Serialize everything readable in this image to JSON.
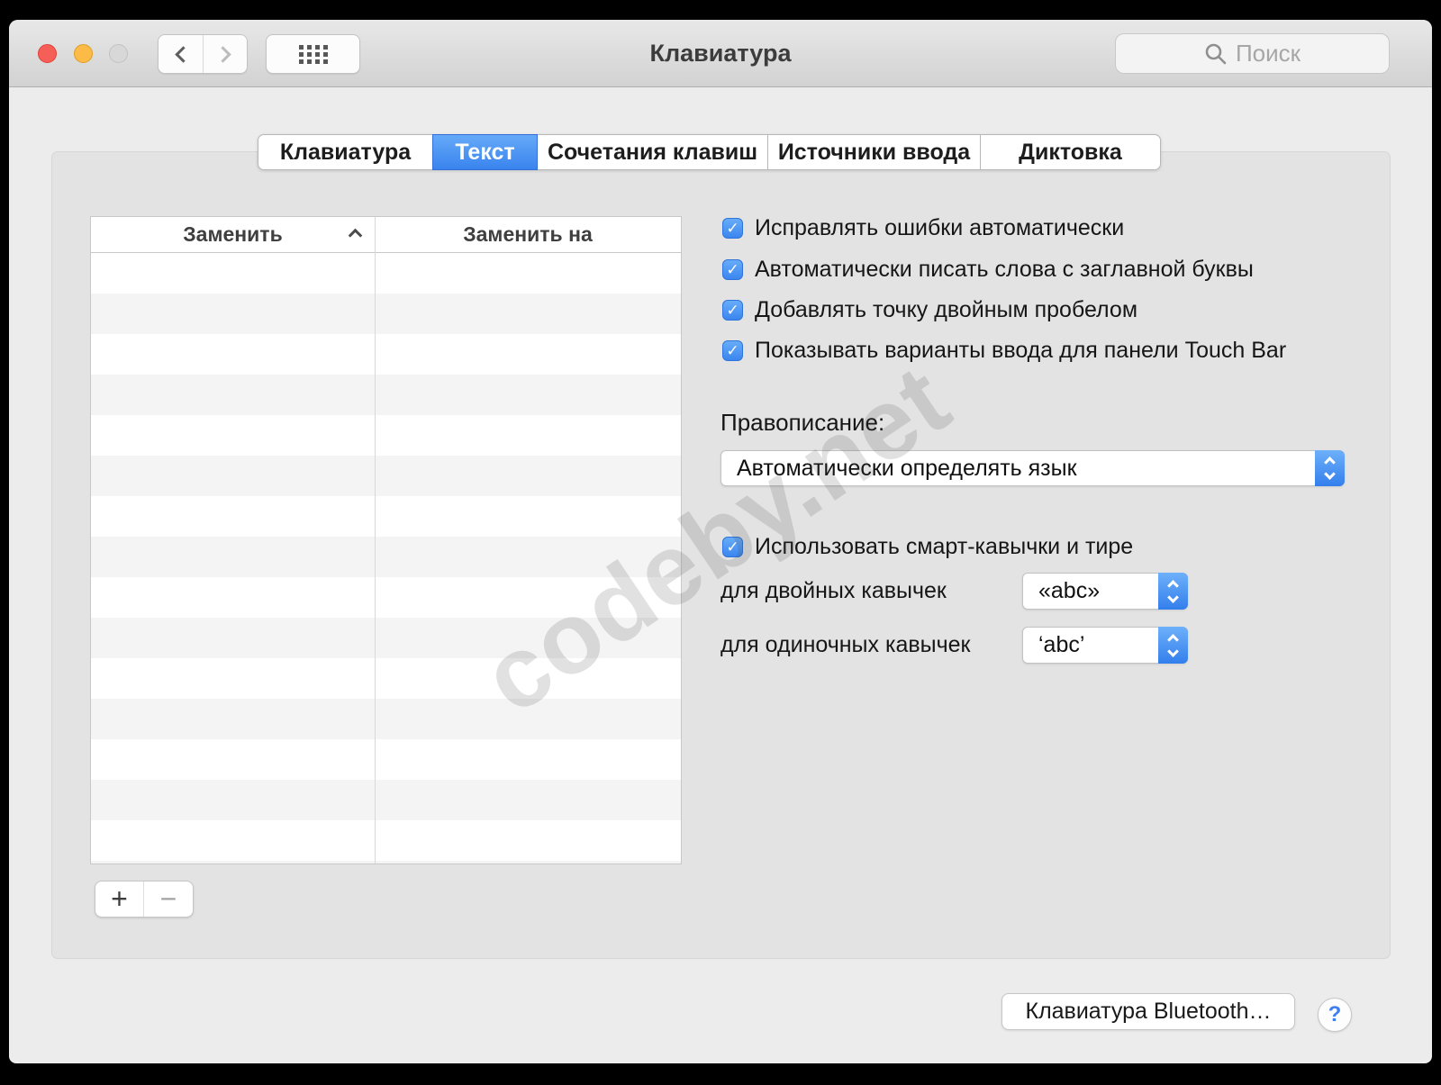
{
  "titlebar": {
    "title": "Клавиатура",
    "search_placeholder": "Поиск"
  },
  "tabs": [
    {
      "label": "Клавиатура",
      "active": false
    },
    {
      "label": "Текст",
      "active": true
    },
    {
      "label": "Сочетания клавиш",
      "active": false
    },
    {
      "label": "Источники ввода",
      "active": false
    },
    {
      "label": "Диктовка",
      "active": false
    }
  ],
  "table": {
    "columns": [
      "Заменить",
      "Заменить на"
    ],
    "rows": []
  },
  "checkboxes": [
    {
      "label": "Исправлять ошибки автоматически",
      "checked": true
    },
    {
      "label": "Автоматически писать слова с заглавной буквы",
      "checked": true
    },
    {
      "label": "Добавлять точку двойным пробелом",
      "checked": true
    },
    {
      "label": "Показывать варианты ввода для панели Touch Bar",
      "checked": true
    }
  ],
  "check_glyph": "✓",
  "spelling": {
    "label": "Правописание:",
    "value": "Автоматически определять язык"
  },
  "smart_quotes": {
    "toggle_label": "Использовать смарт-кавычки и тире",
    "checked": true,
    "double_label": "для двойных кавычек",
    "double_value": "«abc»",
    "single_label": "для одиночных кавычек",
    "single_value": "‘abc’"
  },
  "actions": {
    "add": "+",
    "remove": "−",
    "bluetooth": "Клавиатура Bluetooth…",
    "help": "?"
  },
  "watermark": "codeby.net",
  "colors": {
    "accent_blue": "#4796f2",
    "panel_gray": "#e3e3e3",
    "titlebar_gray": "#d9d9d9"
  }
}
